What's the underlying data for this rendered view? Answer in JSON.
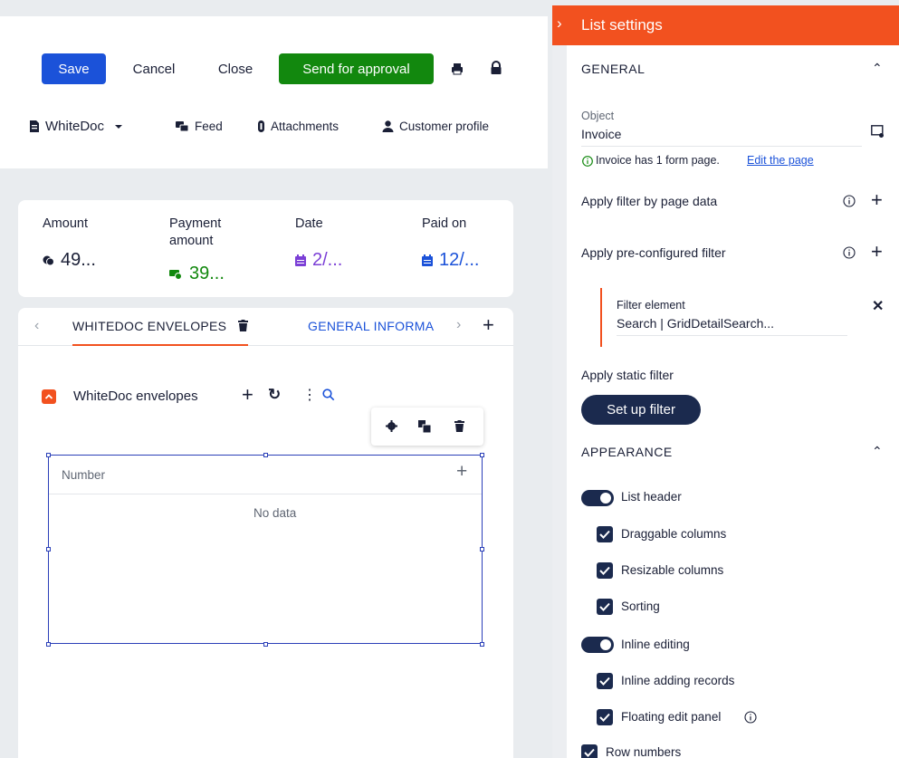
{
  "toolbar": {
    "save": "Save",
    "cancel": "Cancel",
    "close": "Close",
    "send_for_approval": "Send for approval"
  },
  "top_tabs": {
    "whitedoc": "WhiteDoc",
    "feed": "Feed",
    "attachments": "Attachments",
    "customer_profile": "Customer profile"
  },
  "kpis": [
    {
      "label": "Amount",
      "value": "49..."
    },
    {
      "label": "Payment amount",
      "value": "39..."
    },
    {
      "label": "Date",
      "value": "2/..."
    },
    {
      "label": "Paid on",
      "value": "12/..."
    }
  ],
  "detail_tabs": {
    "active": "WHITEDOC ENVELOPES",
    "next": "GENERAL INFORMA"
  },
  "list": {
    "title": "WhiteDoc envelopes",
    "column": "Number",
    "empty": "No data"
  },
  "panel": {
    "title": "List settings",
    "general": "GENERAL",
    "object_label": "Object",
    "object_value": "Invoice",
    "info_text": "Invoice has 1 form page.",
    "info_link": "Edit the page",
    "filter_by_page": "Apply filter by page data",
    "preconfigured": "Apply pre-configured filter",
    "filter_element_label": "Filter element",
    "filter_element_value": "Search | GridDetailSearch...",
    "static_filter": "Apply static filter",
    "set_up_filter": "Set up filter",
    "appearance": "APPEARANCE",
    "list_header": "List header",
    "draggable": "Draggable columns",
    "resizable": "Resizable columns",
    "sorting": "Sorting",
    "inline_editing": "Inline editing",
    "inline_adding": "Inline adding records",
    "floating_panel": "Floating edit panel",
    "row_numbers": "Row numbers"
  },
  "colors": {
    "primary": "#1b52d9",
    "green": "#12880e",
    "orange": "#f2511f",
    "navy": "#1b2a4e",
    "purple": "#7b3fd6"
  }
}
